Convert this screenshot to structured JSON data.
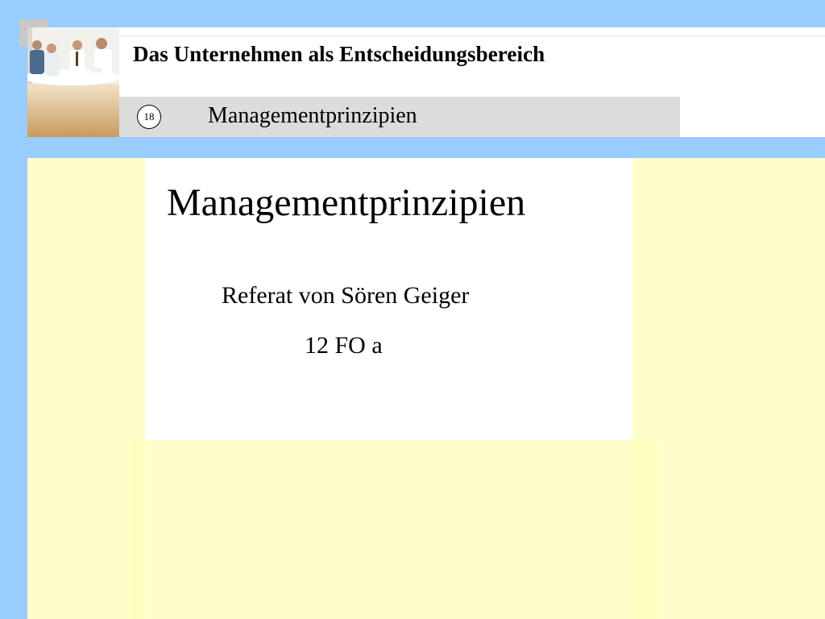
{
  "header": {
    "title": "Das Unternehmen als Entscheidungsbereich",
    "slide_number": "18",
    "section": "Managementprinzipien"
  },
  "photo": {
    "icon": "meeting-photo"
  },
  "slide": {
    "heading": "Managementprinzipien",
    "presenter": "Referat von Sören Geiger",
    "class_code": "12 FO a"
  },
  "colors": {
    "frame_blue": "#99ccff",
    "content_yellow": "#ffffcc",
    "subtitle_gray": "#dcdcdc"
  }
}
